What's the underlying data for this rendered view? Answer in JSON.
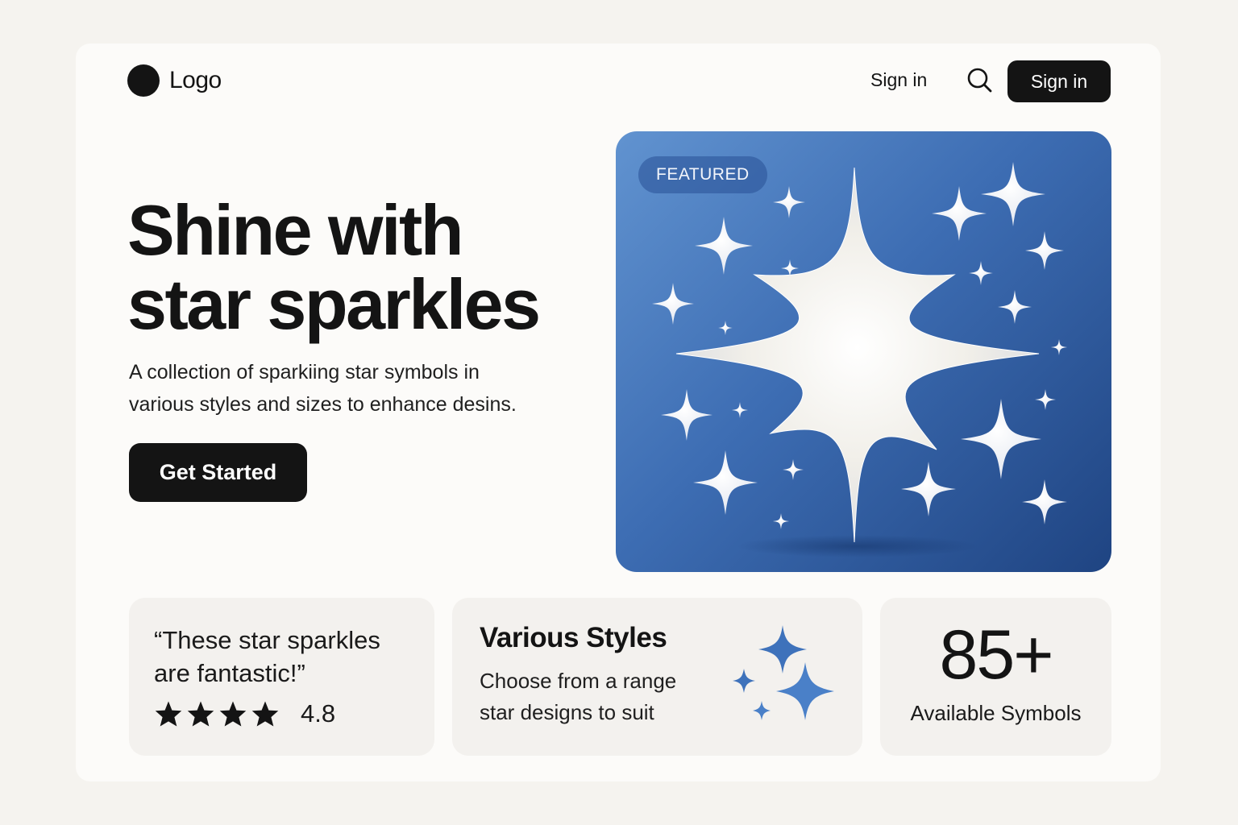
{
  "header": {
    "logo_text": "Logo",
    "signin_link": "Sign in",
    "search_icon": "search-icon",
    "signin_button": "Sign in"
  },
  "hero": {
    "title_line1": "Shine with",
    "title_line2": "star sparkles",
    "description_line1": "A collection of sparkiing star symbols in",
    "description_line2": "various styles and sizes to enhance desins.",
    "cta_label": "Get Started"
  },
  "feature": {
    "badge": "FEATURED",
    "image_subject": "sparkle-stars-illustration"
  },
  "cards": {
    "quote": {
      "line1": "“These star sparkles",
      "line2": "are fantastic!”",
      "stars": 4,
      "rating": "4.8"
    },
    "styles": {
      "title": "Various Styles",
      "desc_line1": "Choose from a range",
      "desc_line2": "star designs to suit"
    },
    "count": {
      "value": "85+",
      "label": "Available Symbols"
    }
  },
  "colors": {
    "primary": "#141414",
    "accent_blue": "#3d6db3",
    "card_bg": "#f3f1ee",
    "page_bg": "#fcfbf9"
  }
}
